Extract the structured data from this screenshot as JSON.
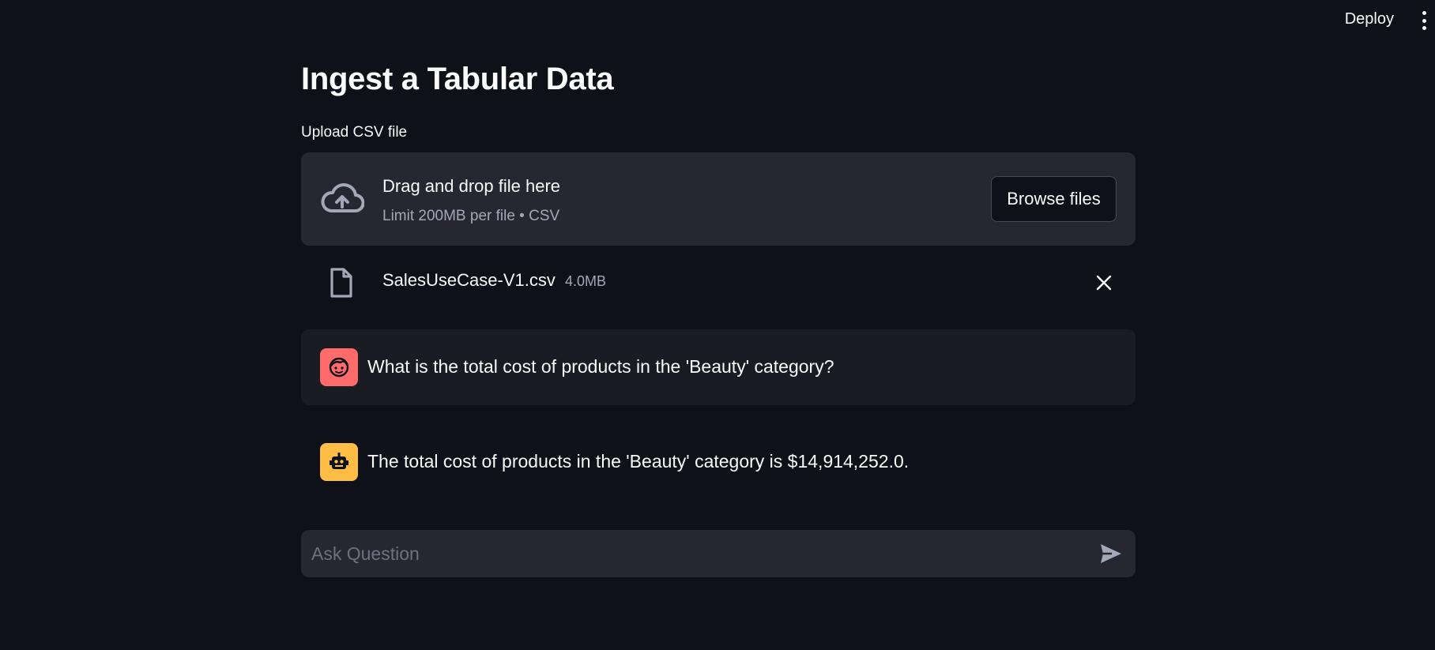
{
  "header": {
    "deploy_label": "Deploy"
  },
  "page": {
    "title": "Ingest a Tabular Data"
  },
  "uploader": {
    "label": "Upload CSV file",
    "drop_title": "Drag and drop file here",
    "drop_subtitle": "Limit 200MB per file • CSV",
    "browse_label": "Browse files"
  },
  "uploaded_file": {
    "name": "SalesUseCase-V1.csv",
    "size": "4.0MB"
  },
  "chat": {
    "messages": [
      {
        "role": "user",
        "text": "What is the total cost of products in the 'Beauty' category?"
      },
      {
        "role": "assistant",
        "text": "The total cost of products in the 'Beauty' category is $14,914,252.0."
      }
    ],
    "input_placeholder": "Ask Question"
  },
  "colors": {
    "background": "#0e1117",
    "surface": "#262730",
    "user_avatar": "#ff6b6b",
    "assistant_avatar": "#ffbd45"
  },
  "icons": {
    "menu": "kebab-menu-icon",
    "upload": "cloud-upload-icon",
    "file": "file-icon",
    "remove": "close-icon",
    "user_avatar": "face-icon",
    "assistant_avatar": "robot-icon",
    "send": "send-icon"
  }
}
